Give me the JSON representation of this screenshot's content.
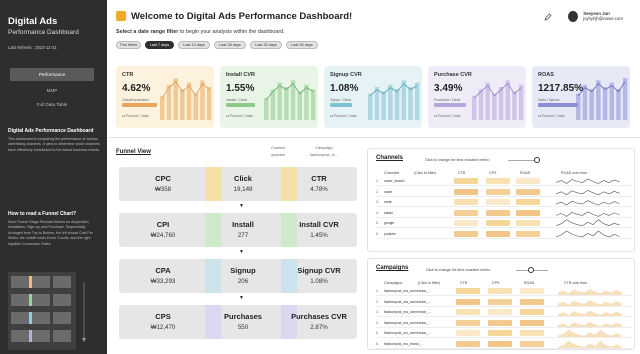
{
  "sidebar": {
    "title": "Digital Ads",
    "subtitle": "Performance Dashboard",
    "last_refresh": "Last Refresh : 2023-12-31",
    "nav": [
      {
        "label": "Performance",
        "active": true
      },
      {
        "label": "MMP",
        "active": false
      },
      {
        "label": "Full Data Table",
        "active": false
      }
    ],
    "about_heading": "Digital Ads Performance Dashboard",
    "about_text": "This dashboard is comparing the performance of various advertising channels. It aims to determine which channels have effectively contributed to the actual business results.",
    "howto_heading": "How to read a Funnel Chart?",
    "howto_text": "Each Funnel Stage Reveals Metrics for Acquisition, Installation, Sign-up, and Purchase. Sequentially Arranged from Top to Bottom, the left shows Cost Per Metric, the middle holds Event Counts, and the right signifies Conversion Rates."
  },
  "header": {
    "title": "Welcome to Digital Ads Performance Dashboard!",
    "instruction_bold": "Select a date range filter",
    "instruction_rest": " to begin your analysis within the dashboard.",
    "user_name": "Seeyeon Jun",
    "user_email": "jsyhyhjh@naver.com"
  },
  "date_filters": [
    {
      "label": "This Week",
      "active": false
    },
    {
      "label": "Last 7 days",
      "active": true
    },
    {
      "label": "Last 14 days",
      "active": false
    },
    {
      "label": "Last 28 days",
      "active": false
    },
    {
      "label": "Last 30 days",
      "active": false
    },
    {
      "label": "Last 90 days",
      "active": false
    }
  ],
  "kpis": [
    {
      "name": "CTR",
      "value": "4.62%",
      "label": "Clicks/Impressions",
      "note": "vs Previous 7 days",
      "bg": "#fdf2de",
      "accent": "#e9a65a",
      "line": "#dba263",
      "bars": [
        0.55,
        0.8,
        0.95,
        0.7,
        0.85,
        0.6,
        0.9,
        0.75
      ],
      "fill": 0.55
    },
    {
      "name": "Install CVR",
      "value": "1.55%",
      "label": "Installs / Clicks",
      "note": "vs Previous 7 days",
      "bg": "#e9f5e6",
      "accent": "#8cc98a",
      "line": "#6fb072",
      "bars": [
        0.5,
        0.7,
        0.85,
        0.75,
        0.9,
        0.65,
        0.8,
        0.7
      ],
      "fill": 0.45
    },
    {
      "name": "Signup CVR",
      "value": "1.08%",
      "label": "Signup / Clicks",
      "note": "vs Previous 7 days",
      "bg": "#e6f3f6",
      "accent": "#7fc0d2",
      "line": "#5fa8bc",
      "bars": [
        0.6,
        0.75,
        0.65,
        0.8,
        0.7,
        0.9,
        0.75,
        0.85
      ],
      "fill": 0.35
    },
    {
      "name": "Purchase CVR",
      "value": "3.49%",
      "label": "Purchases / Clicks",
      "note": "vs Previous 7 days",
      "bg": "#efecf8",
      "accent": "#b4a5dd",
      "line": "#9a88cc",
      "bars": [
        0.55,
        0.7,
        0.85,
        0.6,
        0.75,
        0.9,
        0.65,
        0.8
      ],
      "fill": 0.5
    },
    {
      "name": "ROAS",
      "value": "1217.85%",
      "label": "Sales / Spends",
      "note": "vs Previous 7 days",
      "bg": "#e8e9f7",
      "accent": "#8a8fd6",
      "line": "#6d72c2",
      "bars": [
        0.6,
        0.8,
        0.7,
        0.9,
        0.75,
        0.85,
        0.7,
        0.95
      ],
      "fill": 0.62
    }
  ],
  "funnel": {
    "title": "Funnel View",
    "channel_label": "Channel",
    "channel_value": "youtube",
    "campaign_label": "Campaign",
    "campaign_value": "fashionpost_m...",
    "stages": [
      {
        "left_label": "CPC",
        "left_value": "₩358",
        "mid_label": "Click",
        "mid_value": "19,149",
        "right_label": "CTR",
        "right_value": "4.78%",
        "color": "#f7dfa8"
      },
      {
        "left_label": "CPI",
        "left_value": "₩24,760",
        "mid_label": "Install",
        "mid_value": "277",
        "right_label": "Install CVR",
        "right_value": "1.45%",
        "color": "#cfe9cb"
      },
      {
        "left_label": "CPA",
        "left_value": "₩33,293",
        "mid_label": "Signup",
        "mid_value": "206",
        "right_label": "Signup CVR",
        "right_value": "1.08%",
        "color": "#cbe3ed"
      },
      {
        "left_label": "CPS",
        "left_value": "₩12,470",
        "mid_label": "Purchases",
        "mid_value": "550",
        "right_label": "Purchases CVR",
        "right_value": "2.87%",
        "color": "#ddd6f0"
      }
    ]
  },
  "channels": {
    "title": "Channels",
    "hint": "Click to change the time-mosaied metric:",
    "headers": [
      "Channels",
      "(Click to filter)",
      "CTR",
      "CPS",
      "ROAS",
      "ROAS over time"
    ],
    "rows": [
      {
        "num": "1.",
        "name": "naver_search"
      },
      {
        "num": "2.",
        "name": "naver"
      },
      {
        "num": "3.",
        "name": "meta"
      },
      {
        "num": "4.",
        "name": "kakao"
      },
      {
        "num": "5.",
        "name": "google"
      },
      {
        "num": "6.",
        "name": "youtube"
      }
    ]
  },
  "campaigns": {
    "title": "Campaigns",
    "hint": "Click to change the time-mosaied metric:",
    "headers": [
      "Campaigns",
      "(Click to filter)",
      "CTR",
      "CPS",
      "ROAS",
      "CTR over time"
    ],
    "rows": [
      {
        "num": "1.",
        "name": "fashionpost_ma_conversion_..."
      },
      {
        "num": "2.",
        "name": "fashionpost_ma_conversion_..."
      },
      {
        "num": "3.",
        "name": "fashionpost_ma_conversion_..."
      },
      {
        "num": "4.",
        "name": "fashionpost_ma_conversion_..."
      },
      {
        "num": "5.",
        "name": "fashionpost_mo_conversion_..."
      },
      {
        "num": "6.",
        "name": "fashionpost_mo_brand_..."
      }
    ]
  },
  "colors": {
    "sidebar": "#2e2e2e",
    "accent_yellow": "#f3a92f"
  }
}
